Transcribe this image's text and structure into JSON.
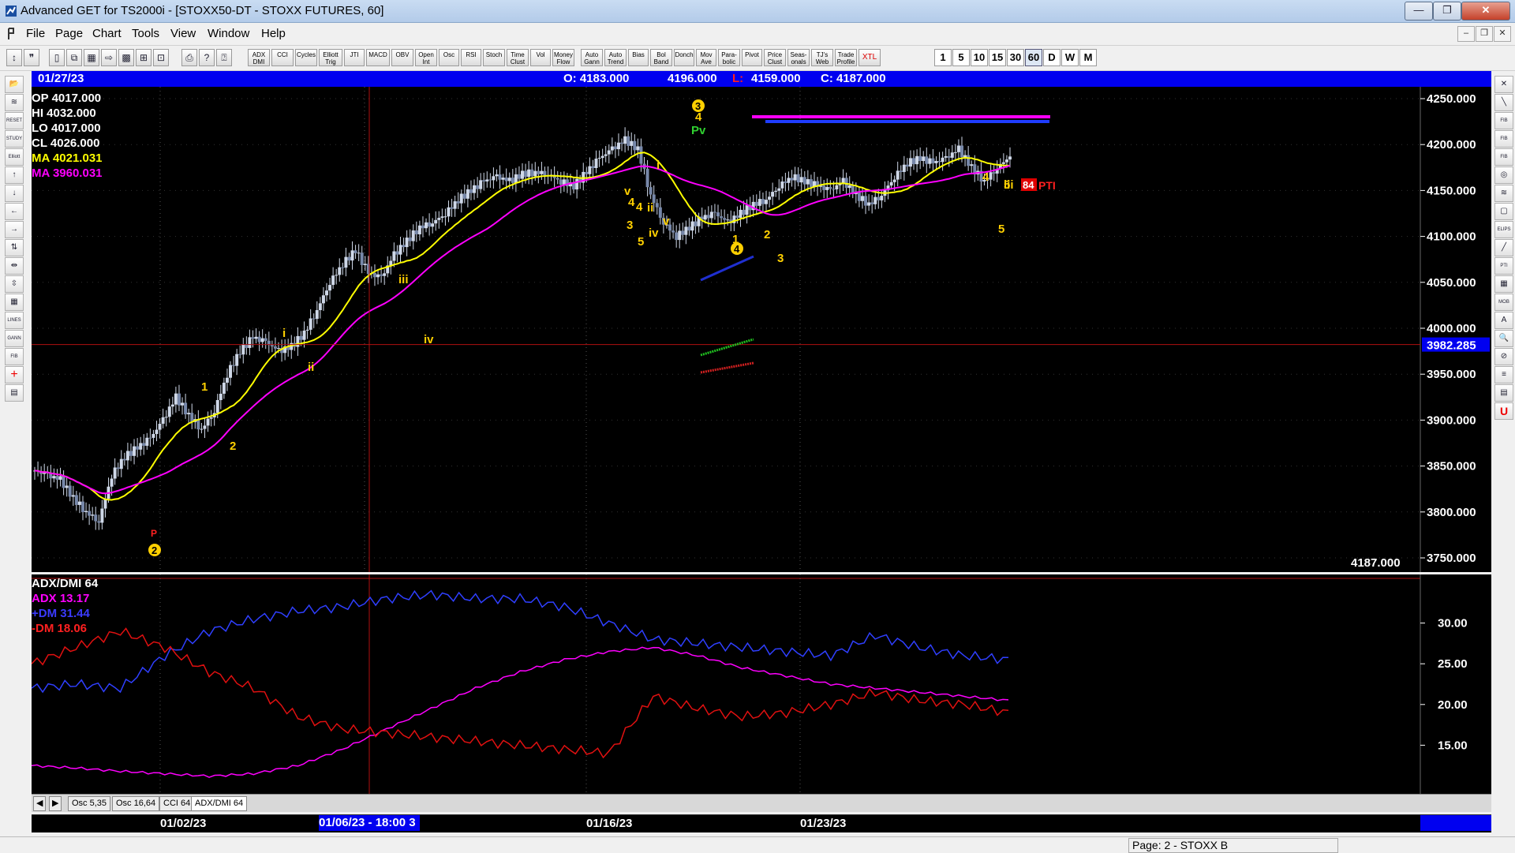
{
  "window": {
    "title": "Advanced GET for TS2000i - [STOXX50-DT - STOXX FUTURES, 60]",
    "minimize": "—",
    "maximize": "❐",
    "close": "✕"
  },
  "menu": {
    "items": [
      "File",
      "Page",
      "Chart",
      "Tools",
      "View",
      "Window",
      "Help"
    ],
    "mdi_minimize": "–",
    "mdi_restore": "❐",
    "mdi_close": "✕"
  },
  "toolbar": {
    "buttons": [
      "ADX DMI",
      "CCI",
      "Cycles",
      "Elliott Trig",
      "JTI",
      "MACD",
      "OBV",
      "Open Int",
      "Osc",
      "RSI",
      "Stoch",
      "Time Clust",
      "Vol",
      "Money Flow",
      "Auto Gann",
      "Auto Trend",
      "Bias",
      "Bol Band",
      "Donch",
      "Mov Ave",
      "Para- bolic",
      "Pivot",
      "Price Clust",
      "Seas- onals",
      "TJ's Web",
      "Trade Profile",
      "XTL"
    ],
    "timeframes": [
      "1",
      "5",
      "10",
      "15",
      "30",
      "60",
      "D",
      "W",
      "M"
    ],
    "active_timeframe": "60"
  },
  "left_tools": [
    "📂",
    "≋",
    "RESET",
    "STUDY",
    "Elliott",
    "↑",
    "↓",
    "←",
    "→",
    "⇅",
    "⇹",
    "⇳",
    "▦",
    "LINES",
    "GANN",
    "FIB",
    "+",
    "▤"
  ],
  "right_tools": [
    "✕",
    "╲",
    "FIB RET",
    "FIB EXT",
    "FIB TIME",
    "◎",
    "≋",
    "▢",
    "ELIPS",
    "╱",
    "PTI",
    "▦",
    "MOB",
    "A",
    "🔍",
    "⊘",
    "≡",
    "▤",
    "U"
  ],
  "infobar": {
    "date": "01/27/23",
    "open": "O: 4183.000",
    "high": "4196.000",
    "low": "L: 4159.000",
    "close": "C: 4187.000"
  },
  "legend": {
    "op": "OP  4017.000",
    "hi": "HI   4032.000",
    "lo": "LO  4017.000",
    "cl": "CL   4026.000",
    "ma1": "MA  4021.031",
    "ma2": "MA  3960.031"
  },
  "price_axis": {
    "ticks": [
      "4250.000",
      "4200.000",
      "4150.000",
      "4100.000",
      "4050.000",
      "4000.000",
      "3950.000",
      "3900.000",
      "3850.000",
      "3800.000",
      "3750.000"
    ],
    "cursor_value": "3982.285",
    "last_value": "4187.000"
  },
  "elliott_labels": {
    "wave3_circle": "3",
    "wave4_circle": "4",
    "wave2_circle": "2",
    "pti": "84",
    "pti_label": "PTI",
    "pv": "Pv",
    "misc": [
      "1",
      "2",
      "i",
      "ii",
      "iii",
      "iv",
      "v",
      "3",
      "4",
      "5",
      "1",
      "2",
      "3",
      "4",
      "5",
      "iii",
      "i",
      "ii",
      "iv",
      "v",
      "4",
      "5"
    ]
  },
  "indicator": {
    "title": "ADX/DMI 64",
    "adx": "ADX 13.17",
    "pdm": "+DM 31.44",
    "mdm": "-DM  18.06",
    "ticks": [
      "30.00",
      "25.00",
      "20.00",
      "15.00"
    ]
  },
  "chart_data": {
    "type": "candlestick",
    "symbol": "STOXX50-DT - STOXX FUTURES",
    "interval": "60",
    "ylim": [
      3750,
      4250
    ],
    "x_dates": [
      "01/02/23",
      "01/06/23 - 18:00 3",
      "01/16/23",
      "01/23/23"
    ],
    "moving_averages": [
      {
        "name": "MA",
        "last": 4021.031
      },
      {
        "name": "MA",
        "last": 3960.031
      }
    ],
    "approx_close_path": [
      3845,
      3840,
      3835,
      3815,
      3800,
      3790,
      3840,
      3860,
      3870,
      3880,
      3900,
      3925,
      3905,
      3890,
      3910,
      3950,
      3975,
      3990,
      3985,
      3975,
      3980,
      3995,
      4020,
      4050,
      4070,
      4085,
      4060,
      4055,
      4080,
      4095,
      4110,
      4115,
      4125,
      4140,
      4150,
      4160,
      4165,
      4160,
      4168,
      4170,
      4168,
      4160,
      4155,
      4170,
      4185,
      4195,
      4205,
      4195,
      4145,
      4115,
      4100,
      4110,
      4120,
      4125,
      4115,
      4125,
      4135,
      4140,
      4155,
      4165,
      4160,
      4155,
      4150,
      4160,
      4145,
      4135,
      4145,
      4165,
      4180,
      4185,
      4180,
      4185,
      4195,
      4175,
      4160,
      4175,
      4187
    ],
    "indicator": {
      "name": "ADX/DMI 64",
      "ylim": [
        10,
        35
      ],
      "series": [
        {
          "name": "ADX",
          "last": 13.17
        },
        {
          "name": "+DM",
          "last": 31.44
        },
        {
          "name": "-DM",
          "last": 18.06
        }
      ],
      "adx_path": [
        12.5,
        12.2,
        11.8,
        11.5,
        11.2,
        11.5,
        12.5,
        14.5,
        17,
        19.5,
        22,
        24,
        25.5,
        26.5,
        27,
        26,
        24.5,
        23.5,
        22.5,
        22,
        21.5,
        21,
        20.5
      ],
      "pdm_path": [
        22,
        22.5,
        22,
        26,
        29,
        30.5,
        31.5,
        32,
        33,
        33.5,
        33,
        33,
        32,
        30,
        28,
        27.5,
        27,
        26.5,
        26,
        28.5,
        27,
        26,
        25.5
      ],
      "mdm_path": [
        25,
        27,
        29,
        27,
        24,
        22,
        18.5,
        17,
        16.5,
        16,
        15.5,
        15,
        14.5,
        14,
        21,
        19.5,
        18.5,
        19,
        20,
        21.5,
        20.5,
        20,
        19
      ]
    }
  },
  "tabs": [
    "Osc 5,35",
    "Osc 16,64",
    "CCI 64",
    "ADX/DMI 64"
  ],
  "status": {
    "page": "Page: 2 - STOXX B"
  }
}
